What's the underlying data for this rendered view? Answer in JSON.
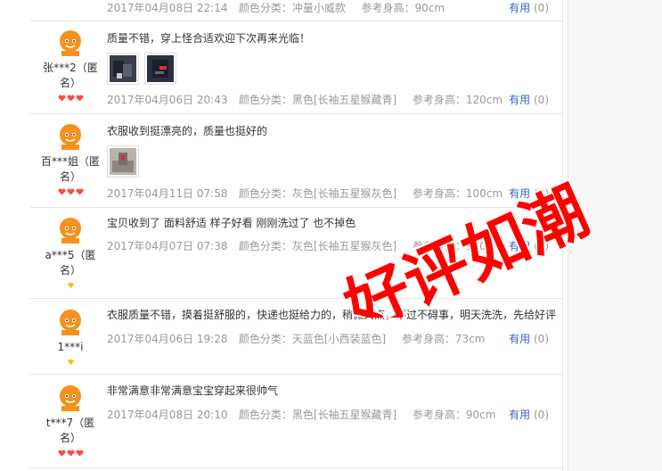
{
  "reviews": [
    {
      "content": "",
      "date": "2017年04月08日 22:14",
      "color": "颜色分类：冲量小威款",
      "height": "参考身高：90cm",
      "useful_label": "有用",
      "useful_count": "(0)"
    },
    {
      "user": "张***2（匿名）",
      "user_line1": "张***2（匿",
      "user_line2": "名）",
      "level_icon": "heart-icon",
      "level_count": 3,
      "content": "质量不错，穿上怪合适欢迎下次再来光临！",
      "date": "2017年04月06日 20:43",
      "color": "颜色分类：黑色[长袖五星猴藏青]",
      "height": "参考身高：120cm",
      "useful_label": "有用",
      "useful_count": "(0)"
    },
    {
      "user": "百***姐（匿名）",
      "user_line1": "百***姐（匿",
      "user_line2": "名）",
      "level_icon": "heart-icon",
      "level_count": 3,
      "content": "衣服收到挺漂亮的，质量也挺好的",
      "date": "2017年04月11日 07:58",
      "color": "颜色分类：灰色[长袖五星猴灰色]",
      "height": "参考身高：100cm",
      "useful_label": "有用",
      "useful_count": "(0)"
    },
    {
      "user": "a***5（匿名）",
      "user_line1": "a***5（匿",
      "user_line2": "名）",
      "level_icon": "diamond-icon",
      "level_count": 1,
      "content": "宝贝收到了 面料舒适 样子好看 刚刚洗过了 也不掉色",
      "date": "2017年04月07日 07:38",
      "color": "颜色分类：灰色[长袖五星猴灰色]",
      "height": "参考身高：100cm",
      "useful_label": "有用",
      "useful_count": "(0)"
    },
    {
      "user": "1***i",
      "level_icon": "diamond-icon",
      "level_count": 1,
      "content": "衣服质量不错，摸着挺舒服的，快递也挺给力的，稍微大点，不过不碍事，明天洗洗，先给好评",
      "date": "2017年04月06日 19:28",
      "color": "颜色分类：天蓝色[小西装蓝色]",
      "height": "参考身高：73cm",
      "useful_label": "有用",
      "useful_count": "(0)"
    },
    {
      "user": "t***7（匿名）",
      "user_line1": "t***7（匿",
      "user_line2": "名）",
      "level_icon": "heart-icon",
      "level_count": 3,
      "content": "非常满意非常满意宝宝穿起来很帅气",
      "date": "2017年04月08日 20:10",
      "color": "颜色分类：黑色[长袖五星猴藏青]",
      "height": "参考身高：90cm",
      "useful_label": "有用",
      "useful_count": "(0)"
    }
  ],
  "stamp_text": "好评如潮",
  "colors": {
    "useful_link": "#3366cc",
    "meta_gray": "#999999",
    "stamp_red": "#ff0000",
    "avatar_orange": "#f5921e"
  }
}
